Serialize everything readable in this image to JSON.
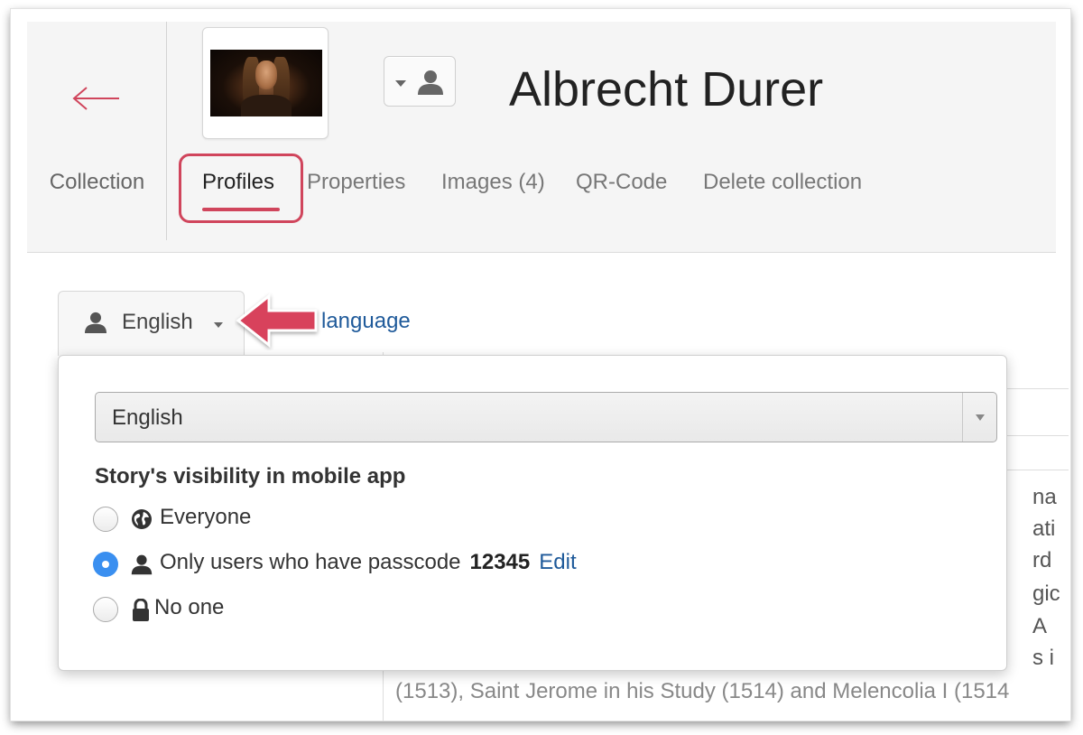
{
  "header": {
    "back_label": "Collection",
    "title": "Albrecht Durer",
    "tabs": [
      {
        "label": "Profiles",
        "active": true
      },
      {
        "label": "Properties",
        "active": false
      },
      {
        "label": "Images (4)",
        "active": false
      },
      {
        "label": "QR-Code",
        "active": false
      },
      {
        "label": "Delete collection",
        "active": false
      }
    ]
  },
  "language": {
    "current": "English",
    "add_link_partial": "language"
  },
  "popover": {
    "select_value": "English",
    "visibility_title": "Story's visibility in mobile app",
    "options": [
      {
        "label": "Everyone",
        "icon": "globe-icon",
        "checked": false
      },
      {
        "label": "Only users who have passcode",
        "icon": "user-icon",
        "checked": true,
        "passcode": "12345",
        "edit_label": "Edit"
      },
      {
        "label": "No one",
        "icon": "lock-icon",
        "checked": false
      }
    ]
  },
  "background_text": {
    "frag1": "na",
    "frag2": "ati",
    "frag3": "rd",
    "frag4": "gic",
    "frag5": "A",
    "frag6": "s i",
    "bottom_line": "(1513), Saint Jerome in his Study (1514) and Melencolia I (1514"
  },
  "colors": {
    "accent_red": "#d0455c",
    "link_blue": "#1f5a9a",
    "radio_blue": "#3a8ff0"
  }
}
